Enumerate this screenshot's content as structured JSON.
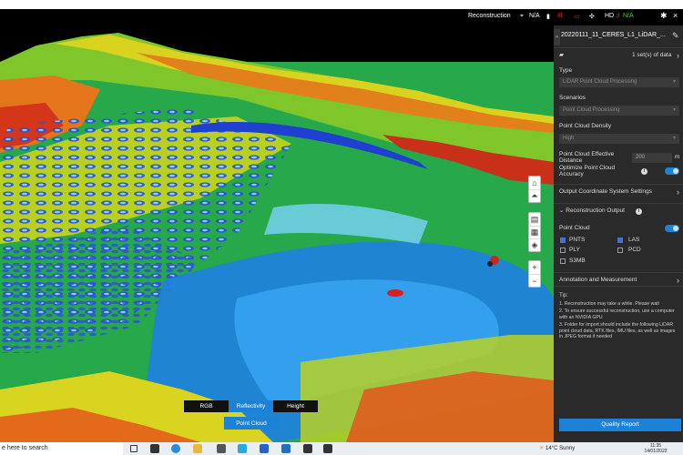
{
  "titlebar": {
    "reconstruction": "Reconstruction",
    "status1": "N/A",
    "status2": "HD",
    "status3": "N/A"
  },
  "viewport": {
    "modes": [
      "RGB",
      "Reflectivity",
      "Height"
    ],
    "active_mode": "Reflectivity",
    "point_cloud_button": "Point Cloud",
    "zoom_in": "+",
    "zoom_out": "−"
  },
  "panel": {
    "title": "20220111_11_CERES_L1_LiDAR_...",
    "data_count": "1 set(s) of data",
    "type_label": "Type",
    "type_value": "LiDAR Point Cloud Processing",
    "scenarios_label": "Scenarios",
    "scenarios_value": "Point Cloud Processing",
    "density_label": "Point Cloud Density",
    "density_value": "High",
    "effective_distance_label": "Point Cloud Effective Distance",
    "effective_distance_value": "200",
    "effective_distance_unit": "m",
    "optimize_label": "Optimize Point Cloud Accuracy",
    "output_coord": "Output Coordinate System Settings",
    "recon_output": "Reconstruction Output",
    "point_cloud_label": "Point Cloud",
    "formats": [
      {
        "name": "PNTS",
        "checked": true
      },
      {
        "name": "LAS",
        "checked": true
      },
      {
        "name": "PLY",
        "checked": false
      },
      {
        "name": "PCD",
        "checked": false
      },
      {
        "name": "S3MB",
        "checked": false
      }
    ],
    "annotation": "Annotation and Measurement",
    "tip_title": "Tip:",
    "tip_1": "1. Reconstruction may take a while. Please wait",
    "tip_2": "2. To ensure successful reconstruction, use a computer with an NVIDIA GPU",
    "tip_3": "3. Folder for import should include the following LiDAR point cloud data, RTK files, IMU files, as well as images in JPEG format if needed",
    "quality_report": "Quality Report"
  },
  "taskbar": {
    "search": "e here to search",
    "weather": "14°C  Sunny",
    "time": "11:35",
    "date": "14/01/2022"
  },
  "colors": {
    "accent": "#1c82d8",
    "panel_bg": "#2a2a2a"
  }
}
